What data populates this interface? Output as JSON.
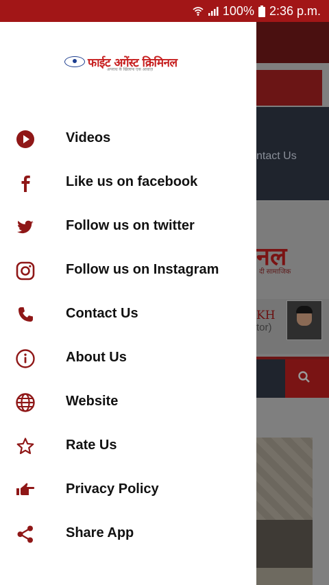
{
  "status_bar": {
    "battery": "100%",
    "time": "2:36 p.m.",
    "background": "#a21617"
  },
  "app": {
    "logo_text": "फाईट अगेंस्ट क्रिमिनल",
    "logo_tagline": "अपराध के खिलाफ एक आवाज़",
    "accent": "#8f1717"
  },
  "drawer": {
    "items": [
      {
        "label": "Videos",
        "icon": "play-circle-icon"
      },
      {
        "label": "Like us on facebook",
        "icon": "facebook-icon"
      },
      {
        "label": "Follow us on twitter",
        "icon": "twitter-icon"
      },
      {
        "label": "Follow us on Instagram",
        "icon": "instagram-icon"
      },
      {
        "label": "Contact Us",
        "icon": "phone-icon"
      },
      {
        "label": "About Us",
        "icon": "info-icon"
      },
      {
        "label": "Website",
        "icon": "globe-icon"
      },
      {
        "label": "Rate Us",
        "icon": "star-icon"
      },
      {
        "label": "Privacy Policy",
        "icon": "hand-pointing-icon"
      },
      {
        "label": "Share App",
        "icon": "share-icon"
      }
    ]
  },
  "background_page": {
    "nav_text": "ntact Us",
    "logo_fragment": "नल",
    "logo_fragment_sub": "दी सामाजिक",
    "editor_name": "KH",
    "editor_role": "tor)"
  }
}
